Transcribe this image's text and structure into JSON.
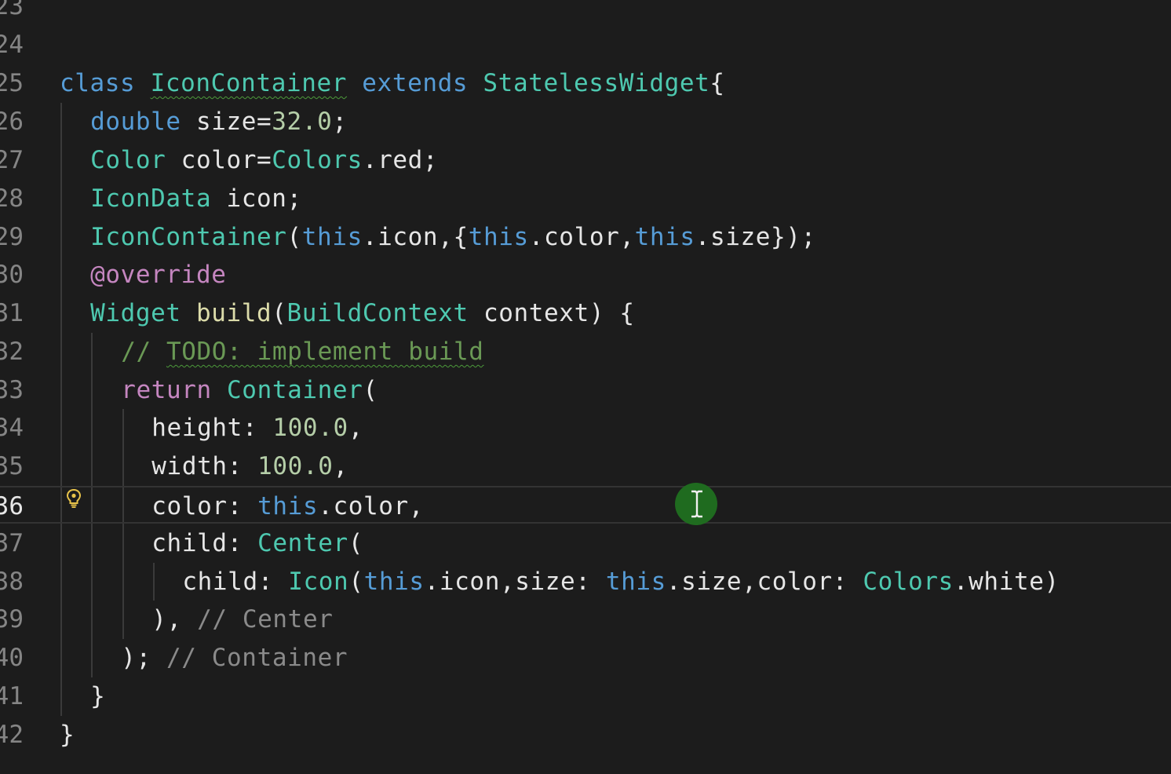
{
  "editor": {
    "current_line": "36",
    "lines": [
      {
        "number": "23",
        "text": ""
      },
      {
        "number": "24",
        "text": ""
      },
      {
        "number": "25",
        "text": "class IconContainer extends StatelessWidget{"
      },
      {
        "number": "26",
        "text": "double size=32.0;"
      },
      {
        "number": "27",
        "text": "Color color=Colors.red;"
      },
      {
        "number": "28",
        "text": "IconData icon;"
      },
      {
        "number": "29",
        "text": "IconContainer(this.icon,{this.color,this.size});"
      },
      {
        "number": "30",
        "text": "@override"
      },
      {
        "number": "31",
        "text": "Widget build(BuildContext context) {"
      },
      {
        "number": "32",
        "text": "// TODO: implement build"
      },
      {
        "number": "33",
        "text": "return Container("
      },
      {
        "number": "34",
        "text": "height: 100.0,"
      },
      {
        "number": "35",
        "text": "width: 100.0,"
      },
      {
        "number": "36",
        "text": "color: this.color,"
      },
      {
        "number": "37",
        "text": "child: Center("
      },
      {
        "number": "38",
        "text": "child: Icon(this.icon,size: this.size,color: Colors.white)"
      },
      {
        "number": "39",
        "text": "), // Center"
      },
      {
        "number": "40",
        "text": "); // Container"
      },
      {
        "number": "41",
        "text": "}"
      },
      {
        "number": "42",
        "text": "}"
      }
    ]
  },
  "icons": {
    "lightbulb": "lightbulb-icon",
    "cursor": "text-cursor-icon"
  },
  "colors": {
    "background": "#1c1c1c",
    "keyword": "#569cd6",
    "type": "#4ec9b0",
    "control": "#c586c0",
    "comment": "#6a9955",
    "number": "#b5cea8",
    "function": "#dcdcaa",
    "cursor_highlight": "#1f6b1f"
  }
}
